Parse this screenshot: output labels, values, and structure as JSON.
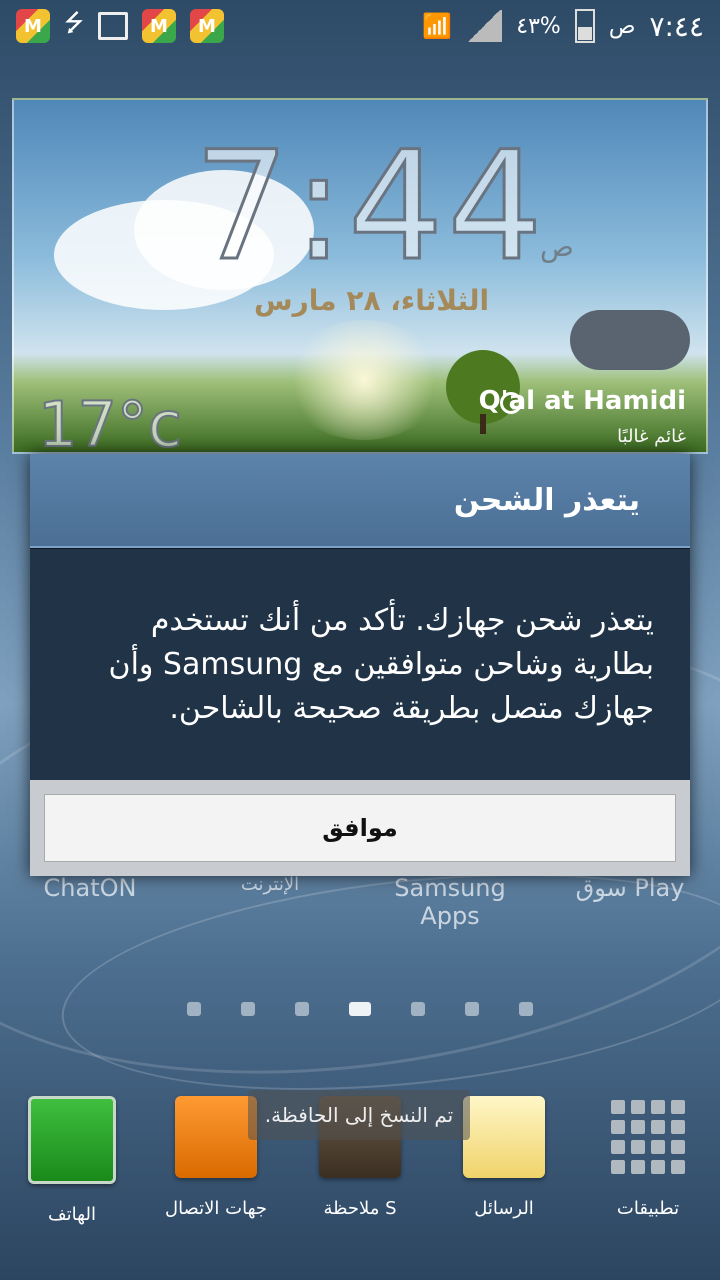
{
  "status_bar": {
    "battery_text": "٤٣%",
    "ampm": "ص",
    "time": "٧:٤٤",
    "notification_icons": [
      "market-icon",
      "usb-icon",
      "gallery-icon",
      "market-icon",
      "market-icon"
    ],
    "right_icons": [
      "wifi-icon",
      "signal-icon",
      "battery-icon"
    ]
  },
  "weather_widget": {
    "time": "7:44",
    "ampm": "ص",
    "date": "الثلاثاء، ٢٨ مارس",
    "temperature": "17°c",
    "location": "Q'al at Hamidi",
    "condition": "غائم غالبًا"
  },
  "background_apps": [
    {
      "label": "ChatON"
    },
    {
      "label": "الإنترنت"
    },
    {
      "label": "Samsung Apps"
    },
    {
      "label": "سوق Play"
    }
  ],
  "page_indicator": {
    "count": 7,
    "active": 3
  },
  "dialog": {
    "title": "يتعذر الشحن",
    "message": "يتعذر شحن جهازك. تأكد من أنك تستخدم بطارية وشاحن متوافقين مع Samsung وأن جهازك متصل بطريقة صحيحة بالشاحن.",
    "ok_label": "موافق"
  },
  "toast": {
    "text": "تم النسخ إلى الحافظة."
  },
  "dock": {
    "items": [
      {
        "label": "الهاتف",
        "icon": "phone-icon"
      },
      {
        "label": "جهات الاتصال",
        "icon": "contacts-icon"
      },
      {
        "label": "S ملاحظة",
        "icon": "snote-icon"
      },
      {
        "label": "الرسائل",
        "icon": "messages-icon"
      },
      {
        "label": "تطبيقات",
        "icon": "apps-icon"
      }
    ]
  },
  "colors": {
    "dialog_header": "#5c83ab",
    "dialog_body": "#213447",
    "button_bg": "#f3f3f3"
  }
}
